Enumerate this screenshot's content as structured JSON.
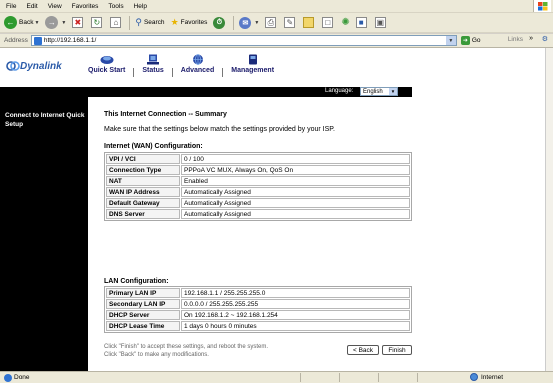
{
  "menu": [
    "File",
    "Edit",
    "View",
    "Favorites",
    "Tools",
    "Help"
  ],
  "toolbar": {
    "back_label": "Back",
    "search_label": "Search",
    "favorites_label": "Favorites"
  },
  "address": {
    "label": "Address",
    "url": "http://192.168.1.1/",
    "go_label": "Go",
    "links_label": "Links"
  },
  "router": {
    "logo_text": "Dynalink",
    "nav": [
      "Quick Start",
      "Status",
      "Advanced",
      "Management"
    ],
    "language_label": "Language:",
    "language_value": "English",
    "sidebar_link": "Connect to Internet Quick Setup",
    "title": "This Internet Connection -- Summary",
    "intro": "Make sure that the settings below match the settings provided by your ISP.",
    "wan_title": "Internet (WAN) Configuration:",
    "wan_rows": [
      {
        "k": "VPI / VCI",
        "v": "0 / 100"
      },
      {
        "k": "Connection Type",
        "v": "PPPoA VC MUX, Always On, QoS On"
      },
      {
        "k": "NAT",
        "v": "Enabled"
      },
      {
        "k": "WAN IP Address",
        "v": "Automatically Assigned"
      },
      {
        "k": "Default Gateway",
        "v": "Automatically Assigned"
      },
      {
        "k": "DNS Server",
        "v": "Automatically Assigned"
      }
    ],
    "lan_title": "LAN Configuration:",
    "lan_rows": [
      {
        "k": "Primary LAN IP",
        "v": "192.168.1.1 / 255.255.255.0"
      },
      {
        "k": "Secondary LAN IP",
        "v": "0.0.0.0 / 255.255.255.255"
      },
      {
        "k": "DHCP Server",
        "v": "On 192.168.1.2 ~ 192.168.1.254"
      },
      {
        "k": "DHCP Lease Time",
        "v": "1 days 0 hours 0 minutes"
      }
    ],
    "footnote_1": "Click \"Finish\" to accept these settings, and reboot the system.",
    "footnote_2": "Click \"Back\" to make any modifications.",
    "back_button": "< Back",
    "finish_button": "Finish"
  },
  "status": {
    "text": "Done",
    "zone": "Internet"
  },
  "colors": {
    "nav_text": "#1a1a6a",
    "logo": "#2a5aa8",
    "sidebar_bg": "#000000"
  }
}
